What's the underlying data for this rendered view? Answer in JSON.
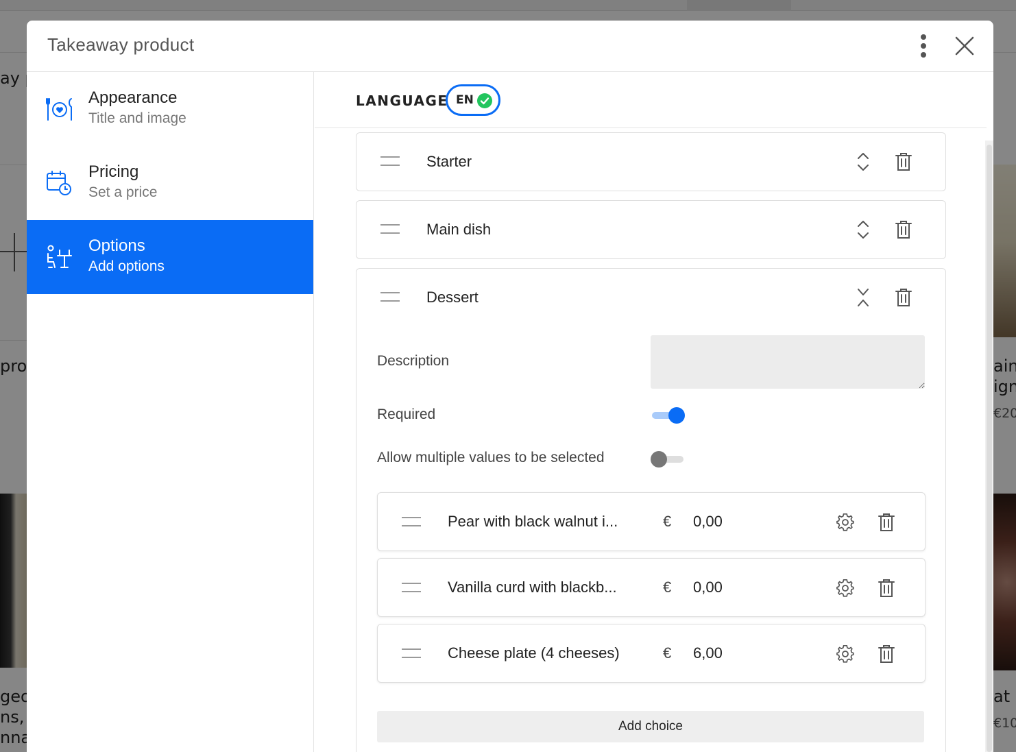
{
  "background": {
    "fragments": [
      "ay p",
      "pro",
      "aine",
      "ign",
      "€20",
      "geo",
      "ns, E",
      "nna",
      "at l",
      "€10"
    ]
  },
  "modal": {
    "title": "Takeaway product"
  },
  "sidebar": {
    "items": [
      {
        "label": "Appearance",
        "sub": "Title and image",
        "icon": "plate-heart-icon",
        "active": false
      },
      {
        "label": "Pricing",
        "sub": "Set a price",
        "icon": "calendar-clock-icon",
        "active": false
      },
      {
        "label": "Options",
        "sub": "Add options",
        "icon": "options-icon",
        "active": true
      }
    ]
  },
  "language": {
    "label": "LANGUAGE",
    "code": "EN",
    "status_icon": "check-circle-icon"
  },
  "options": [
    {
      "title": "Starter",
      "expanded": false
    },
    {
      "title": "Main dish",
      "expanded": false
    },
    {
      "title": "Dessert",
      "expanded": true,
      "description_label": "Description",
      "description_value": "",
      "required_label": "Required",
      "required": true,
      "multiple_label": "Allow multiple values to be selected",
      "multiple": false,
      "choices": [
        {
          "name": "Pear with black walnut i...",
          "currency": "€",
          "price": "0,00"
        },
        {
          "name": "Vanilla curd with blackb...",
          "currency": "€",
          "price": "0,00"
        },
        {
          "name": "Cheese plate (4 cheeses)",
          "currency": "€",
          "price": "6,00"
        }
      ],
      "add_choice_label": "Add choice"
    }
  ],
  "colors": {
    "accent": "#0a6cf5",
    "success": "#22c55e"
  }
}
